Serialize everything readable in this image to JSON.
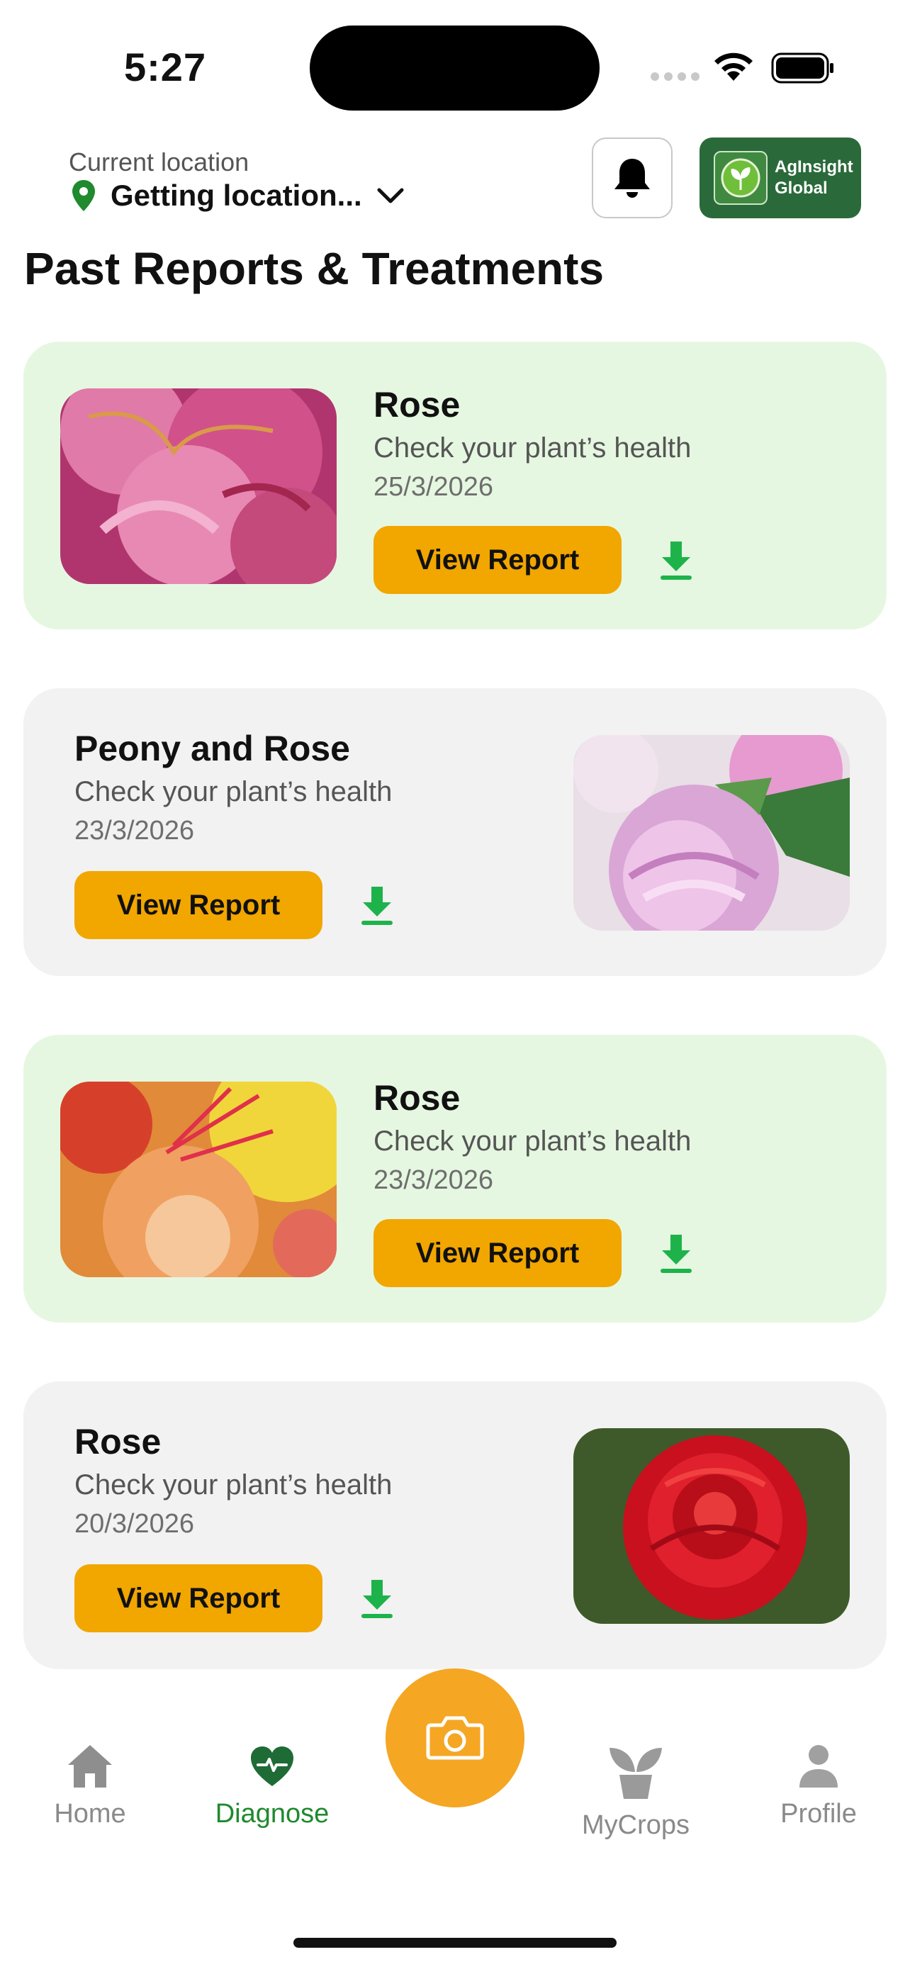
{
  "status_bar": {
    "time": "5:27"
  },
  "header": {
    "location_label": "Current location",
    "location_value": "Getting location...",
    "logo_line1": "AgInsight",
    "logo_line2": "Global"
  },
  "page_title": "Past Reports & Treatments",
  "reports": [
    {
      "title": "Rose",
      "subtitle": "Check your plant’s health",
      "date": "25/3/2026",
      "button": "View Report"
    },
    {
      "title": "Peony and Rose",
      "subtitle": "Check your plant’s health",
      "date": "23/3/2026",
      "button": "View Report"
    },
    {
      "title": "Rose",
      "subtitle": "Check your plant’s health",
      "date": "23/3/2026",
      "button": "View Report"
    },
    {
      "title": "Rose",
      "subtitle": "Check your plant’s health",
      "date": "20/3/2026",
      "button": "View Report"
    }
  ],
  "tabs": {
    "home": "Home",
    "diagnose": "Diagnose",
    "mycrops": "MyCrops",
    "profile": "Profile"
  },
  "colors": {
    "accent_orange": "#f1a600",
    "brand_green": "#2a6a3a",
    "active_tab_green": "#1f8a2e",
    "download_green": "#1db34a",
    "card_green": "#e6f7e1",
    "card_gray": "#f2f2f2"
  },
  "icons": {
    "location": "map-pin-icon",
    "dropdown": "chevron-down-icon",
    "notifications": "bell-icon",
    "download": "download-icon",
    "camera": "camera-icon",
    "home": "home-icon",
    "diagnose": "heart-pulse-icon",
    "mycrops": "plant-pot-icon",
    "profile": "person-icon"
  }
}
